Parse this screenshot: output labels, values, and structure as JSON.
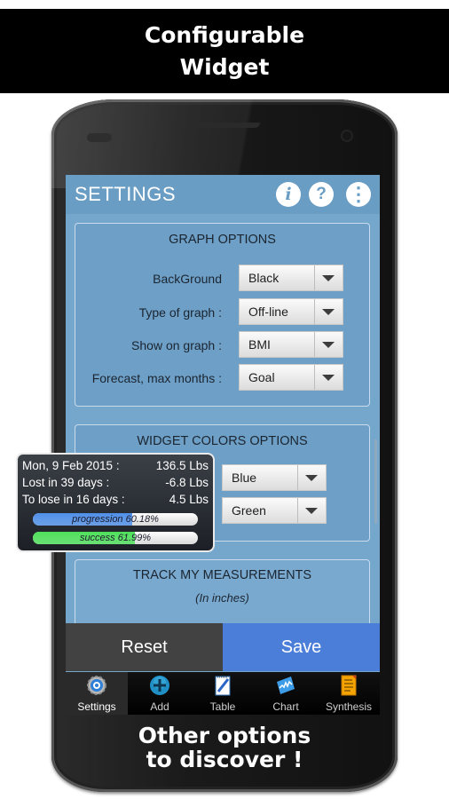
{
  "promo": {
    "top_line1": "Configurable",
    "top_line2": "Widget",
    "bottom_line1": "Other options",
    "bottom_line2": "to discover !"
  },
  "appbar": {
    "title": "SETTINGS",
    "info_icon": "i",
    "help_icon": "?",
    "menu_icon": "⋮"
  },
  "graph_options": {
    "title": "GRAPH OPTIONS",
    "rows": [
      {
        "label": "BackGround",
        "value": "Black"
      },
      {
        "label": "Type of graph :",
        "value": "Off-line"
      },
      {
        "label": "Show on graph :",
        "value": "BMI"
      },
      {
        "label": "Forecast, max months :",
        "value": "Goal"
      }
    ]
  },
  "widget_colors": {
    "title": "WIDGET COLORS OPTIONS",
    "rows": [
      {
        "value": "Blue"
      },
      {
        "value": "Green"
      }
    ]
  },
  "measurements": {
    "title": "TRACK MY MEASUREMENTS",
    "subtitle": "(In inches)"
  },
  "actions": {
    "reset_label": "Reset",
    "save_label": "Save"
  },
  "tabs": [
    {
      "label": "Settings",
      "icon": "gear-icon",
      "active": true
    },
    {
      "label": "Add",
      "icon": "plus-icon",
      "active": false
    },
    {
      "label": "Table",
      "icon": "notepad-icon",
      "active": false
    },
    {
      "label": "Chart",
      "icon": "chart-icon",
      "active": false
    },
    {
      "label": "Synthesis",
      "icon": "document-icon",
      "active": false
    }
  ],
  "widget": {
    "rows": [
      {
        "label": "Mon, 9 Feb 2015 :",
        "value": "136.5 Lbs"
      },
      {
        "label": "Lost in 39 days :",
        "value": "-6.8 Lbs"
      },
      {
        "label": "To lose in 16 days :",
        "value": "4.5 Lbs"
      }
    ],
    "progression": {
      "text": "progression 60.18%",
      "percent": 60.18,
      "color": "#4f8fe8"
    },
    "success": {
      "text": "success 61.99%",
      "percent": 61.99,
      "color": "#4ee05a"
    }
  }
}
